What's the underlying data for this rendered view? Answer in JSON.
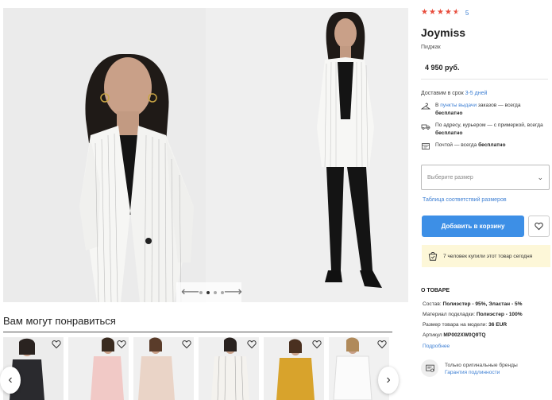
{
  "product": {
    "rating_count": "5",
    "brand": "Joymiss",
    "category": "Пиджак",
    "price": "4 950 руб."
  },
  "rating": {
    "stars": 4.5,
    "max": 5
  },
  "delivery": {
    "time_prefix": "Доставим в срок ",
    "time_value": "3-5 дней",
    "pickup_pre": "В ",
    "pickup_link": "пункты выдачи",
    "pickup_post": " заказов — всегда ",
    "pickup_bold": "бесплатно",
    "courier_text": "По адресу, курьером — с примеркой, всегда ",
    "courier_bold": "бесплатно",
    "post_text": "Почтой — всегда ",
    "post_bold": "бесплатно"
  },
  "size_select": {
    "placeholder": "Выберите размер"
  },
  "size_table_link": "Таблица соответствий размеров",
  "cart_button": "Добавить в корзину",
  "bought_today": "7 человек купили этот товар сегодня",
  "about": {
    "title": "О ТОВАРЕ",
    "composition_label": "Состав: ",
    "composition_value": "Полиэстер - 95%, Эластан - 5%",
    "lining_label": "Материал подкладки: ",
    "lining_value": "Полиэстер - 100%",
    "model_size_label": "Размер товара на модели: ",
    "model_size_value": "36 EUR",
    "sku_label": "Артикул ",
    "sku_value": "MP002XW0Q9TQ",
    "more_link": "Подробнее"
  },
  "original": {
    "line1": "Только оригинальные бренды",
    "line2": "Гарантия подлинности"
  },
  "recommendations_title": "Вам могут понравиться",
  "gallery": {
    "slides": 4,
    "active": 1
  },
  "colors": {
    "accent": "#3d8fe6",
    "link": "#3d7fd3",
    "star": "#e84d3d",
    "bought_bg": "#fdf7d8"
  },
  "icons": [
    "star-icon",
    "hanger-icon",
    "courier-icon",
    "post-icon",
    "chevron-down-icon",
    "heart-icon",
    "cart-check-icon",
    "certificate-icon",
    "arrow-left-icon",
    "arrow-right-icon"
  ]
}
